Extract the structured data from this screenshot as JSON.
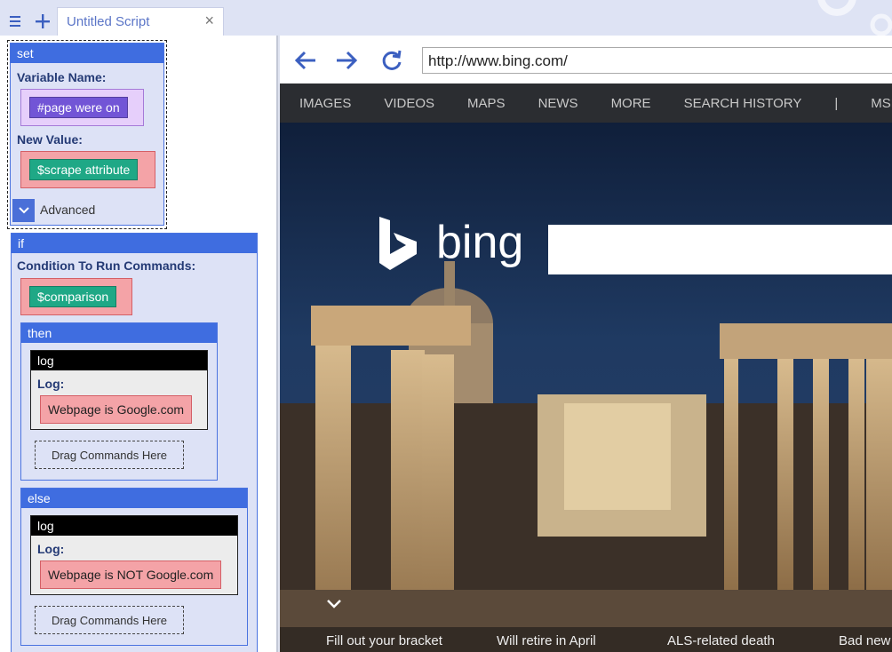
{
  "topbar": {
    "menu_icon": "menu-icon",
    "add_icon": "plus-icon",
    "tab_title": "Untitled Script",
    "close_symbol": "×"
  },
  "editor": {
    "set_block": {
      "header": "set",
      "variable_label": "Variable Name:",
      "variable_value": "#page were on",
      "new_value_label": "New Value:",
      "new_value": "$scrape attribute",
      "advanced_label": "Advanced"
    },
    "if_block": {
      "header": "if",
      "condition_label": "Condition To Run Commands:",
      "condition_value": "$comparison",
      "then_block": {
        "header": "then",
        "log_header": "log",
        "log_label": "Log:",
        "log_value": "Webpage is Google.com",
        "drop_label": "Drag Commands Here"
      },
      "else_block": {
        "header": "else",
        "log_header": "log",
        "log_label": "Log:",
        "log_value": "Webpage is NOT Google.com",
        "drop_label": "Drag Commands Here"
      }
    }
  },
  "browser": {
    "url": "http://www.bing.com/",
    "bing_nav": [
      "IMAGES",
      "VIDEOS",
      "MAPS",
      "NEWS",
      "MORE",
      "SEARCH HISTORY",
      "|",
      "MSN"
    ],
    "logo_text": "bing",
    "ticker": [
      "Fill out your bracket",
      "Will retire in April",
      "ALS-related death",
      "Bad new"
    ]
  },
  "colors": {
    "block_header": "#3f6de0",
    "block_bg": "#dde2f6",
    "slot_red": "#f4a3a7",
    "chip_teal": "#1fa886",
    "chip_purple": "#7255d6",
    "accent_blue": "#3b5fc0"
  }
}
